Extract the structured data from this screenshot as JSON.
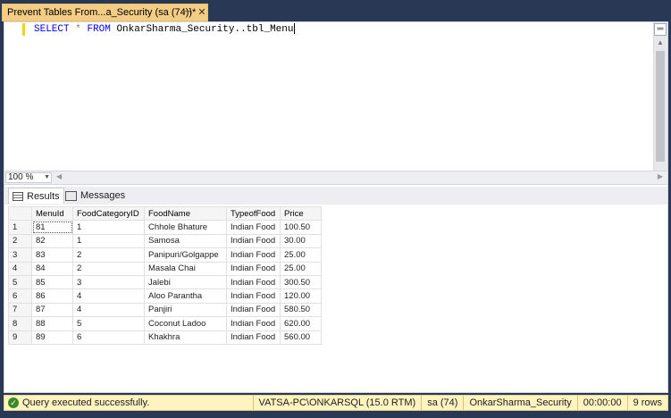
{
  "document_tab": {
    "title": "Prevent Tables From...a_Security (sa (74))*",
    "pin_glyph": "⊣",
    "close_glyph": "✕"
  },
  "editor": {
    "kw_select": "SELECT",
    "star": "*",
    "kw_from": "FROM",
    "table_ref": "OnkarSharma_Security..tbl_Menu"
  },
  "zoom": {
    "value": "100 %"
  },
  "results_tabs": [
    {
      "label": "Results",
      "icon": "grid-icon"
    },
    {
      "label": "Messages",
      "icon": "messages-icon"
    }
  ],
  "grid": {
    "columns": [
      "MenuId",
      "FoodCategoryID",
      "FoodName",
      "TypeofFood",
      "Price"
    ],
    "rows": [
      [
        "1",
        "81",
        "1",
        "Chhole Bhature",
        "Indian Food",
        "100.50"
      ],
      [
        "2",
        "82",
        "1",
        "Samosa",
        "Indian Food",
        "30.00"
      ],
      [
        "3",
        "83",
        "2",
        "Panipuri/Golgappe",
        "Indian Food",
        "25.00"
      ],
      [
        "4",
        "84",
        "2",
        "Masala Chai",
        "Indian Food",
        "25.00"
      ],
      [
        "5",
        "85",
        "3",
        "Jalebi",
        "Indian Food",
        "300.50"
      ],
      [
        "6",
        "86",
        "4",
        "Aloo Parantha",
        "Indian Food",
        "120.00"
      ],
      [
        "7",
        "87",
        "4",
        "Panjiri",
        "Indian Food",
        "580.50"
      ],
      [
        "8",
        "88",
        "5",
        "Coconut Ladoo",
        "Indian Food",
        "620.00"
      ],
      [
        "9",
        "89",
        "6",
        "Khakhra",
        "Indian Food",
        "560.00"
      ]
    ]
  },
  "status": {
    "message": "Query executed successfully.",
    "server": "VATSA-PC\\ONKARSQL (15.0 RTM)",
    "user": "sa (74)",
    "database": "OnkarSharma_Security",
    "elapsed": "00:00:00",
    "rows": "9 rows"
  },
  "colors": {
    "frame": "#293955",
    "active_tab": "#f5cc84",
    "status_bar": "#fff3c0",
    "keyword": "#0000ff"
  }
}
